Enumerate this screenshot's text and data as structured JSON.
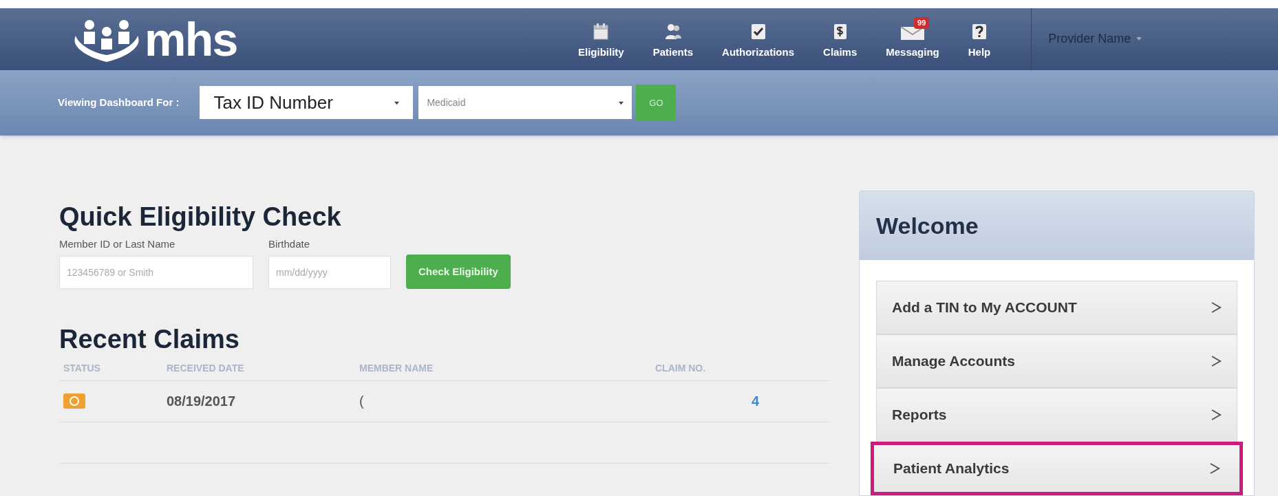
{
  "header": {
    "logo": "mhs",
    "nav": [
      {
        "kind": "calendar",
        "label": "Eligibility"
      },
      {
        "kind": "people",
        "label": "Patients"
      },
      {
        "kind": "check",
        "label": "Authorizations"
      },
      {
        "kind": "dollar",
        "label": "Claims"
      },
      {
        "kind": "mail",
        "label": "Messaging",
        "badge": "99"
      },
      {
        "kind": "help",
        "label": "Help"
      }
    ],
    "user": "Provider Name"
  },
  "dashboard_bar": {
    "label": "Viewing Dashboard For :",
    "tax_id": "Tax ID Number",
    "plan": "Medicaid",
    "go": "GO"
  },
  "quick_check": {
    "title": "Quick Eligibility Check",
    "fields": [
      {
        "label": "Member ID or Last Name",
        "placeholder": "123456789 or Smith"
      },
      {
        "label": "Birthdate",
        "placeholder": "mm/dd/yyyy"
      }
    ],
    "button": "Check Eligibility"
  },
  "recent_claims": {
    "title": "Recent Claims",
    "columns": [
      "STATUS",
      "RECEIVED DATE",
      "MEMBER NAME",
      "CLAIM NO."
    ],
    "rows": [
      {
        "date": "08/19/2017",
        "member": "(",
        "claim": "4"
      }
    ]
  },
  "welcome": {
    "title": "Welcome",
    "items": [
      {
        "label": "Add a TIN to My ACCOUNT",
        "highlighted": false
      },
      {
        "label": "Manage Accounts",
        "highlighted": false
      },
      {
        "label": "Reports",
        "highlighted": false
      },
      {
        "label": "Patient Analytics",
        "highlighted": true
      }
    ]
  }
}
